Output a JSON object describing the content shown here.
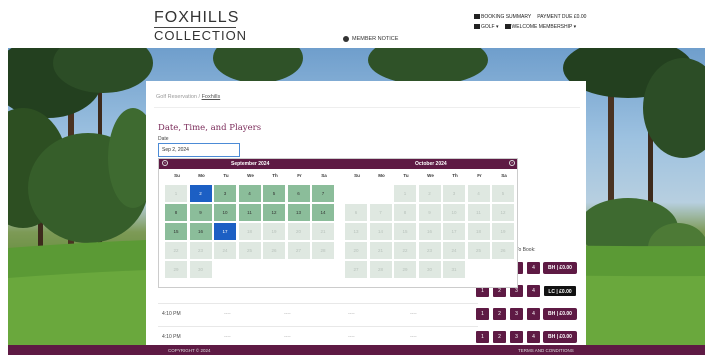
{
  "brand": {
    "line1": "FOXHILLS",
    "line2": "COLLECTION"
  },
  "header": {
    "booking_summary": "BOOKING SUMMARY",
    "payment_due": "PAYMENT DUE £0.00",
    "golf_menu": "GOLF ▾",
    "welcome_menu": "WELCOME MEMBERSHIP ▾",
    "member_notice": "MEMBER NOTICE"
  },
  "breadcrumb": {
    "parent": "Golf Reservation",
    "current": "Foxhills"
  },
  "booking": {
    "section_title": "Date, Time, and Players",
    "date_label": "Date",
    "date_value": "Sep 2, 2024"
  },
  "calendar": {
    "prev": "‹",
    "next": "›",
    "weekdays": [
      "Su",
      "Mo",
      "Tu",
      "We",
      "Th",
      "Fr",
      "Sa"
    ],
    "months": [
      {
        "name": "September 2024",
        "weeks": [
          [
            [
              "1",
              "dim"
            ],
            [
              "2",
              "sel"
            ],
            [
              "3",
              "avail"
            ],
            [
              "4",
              "avail"
            ],
            [
              "5",
              "avail"
            ],
            [
              "6",
              "avail"
            ],
            [
              "7",
              "avail"
            ]
          ],
          [
            [
              "8",
              "avail"
            ],
            [
              "9",
              "avail"
            ],
            [
              "10",
              "avail"
            ],
            [
              "11",
              "avail"
            ],
            [
              "12",
              "avail"
            ],
            [
              "13",
              "avail"
            ],
            [
              "14",
              "avail"
            ]
          ],
          [
            [
              "15",
              "avail"
            ],
            [
              "16",
              "avail"
            ],
            [
              "17",
              "sel"
            ],
            [
              "18",
              "dim"
            ],
            [
              "19",
              "dim"
            ],
            [
              "20",
              "dim"
            ],
            [
              "21",
              "dim"
            ]
          ],
          [
            [
              "22",
              "dim"
            ],
            [
              "23",
              "dim"
            ],
            [
              "24",
              "dim"
            ],
            [
              "25",
              "dim"
            ],
            [
              "26",
              "dim"
            ],
            [
              "27",
              "dim"
            ],
            [
              "28",
              "dim"
            ]
          ],
          [
            [
              "29",
              "dim"
            ],
            [
              "30",
              "dim"
            ]
          ]
        ]
      },
      {
        "name": "October 2024",
        "weeks": [
          [
            [
              "",
              ""
            ],
            [
              "",
              ""
            ],
            [
              "1",
              "dim"
            ],
            [
              "2",
              "dim"
            ],
            [
              "3",
              "dim"
            ],
            [
              "4",
              "dim"
            ],
            [
              "5",
              "dim"
            ]
          ],
          [
            [
              "6",
              "dim"
            ],
            [
              "7",
              "dim"
            ],
            [
              "8",
              "dim"
            ],
            [
              "9",
              "dim"
            ],
            [
              "10",
              "dim"
            ],
            [
              "11",
              "dim"
            ],
            [
              "12",
              "dim"
            ]
          ],
          [
            [
              "13",
              "dim"
            ],
            [
              "14",
              "dim"
            ],
            [
              "15",
              "dim"
            ],
            [
              "16",
              "dim"
            ],
            [
              "17",
              "dim"
            ],
            [
              "18",
              "dim"
            ],
            [
              "19",
              "dim"
            ]
          ],
          [
            [
              "20",
              "dim"
            ],
            [
              "21",
              "dim"
            ],
            [
              "22",
              "dim"
            ],
            [
              "23",
              "dim"
            ],
            [
              "24",
              "dim"
            ],
            [
              "25",
              "dim"
            ],
            [
              "26",
              "dim"
            ]
          ],
          [
            [
              "27",
              "dim"
            ],
            [
              "28",
              "dim"
            ],
            [
              "29",
              "dim"
            ],
            [
              "30",
              "dim"
            ],
            [
              "31",
              "dim"
            ]
          ]
        ]
      }
    ]
  },
  "tee_times": {
    "to_book_label": "To Book:",
    "dash": "----",
    "rows": [
      {
        "time": "",
        "players": [
          "1",
          "2",
          "3",
          "4"
        ],
        "price": "BH | £0.00",
        "style": "purple"
      },
      {
        "time": "",
        "players": [
          "1",
          "2",
          "3",
          "4"
        ],
        "price": "LC | £0.00",
        "style": "dark"
      },
      {
        "time": "4:10 PM",
        "players": [
          "1",
          "2",
          "3",
          "4"
        ],
        "price": "BH | £0.00",
        "style": "purple"
      },
      {
        "time": "4:10 PM",
        "players": [
          "1",
          "2",
          "3",
          "4"
        ],
        "price": "BH | £0.00",
        "style": "purple"
      }
    ]
  },
  "footer": {
    "left": "COPYRIGHT © 2024",
    "right": "TERMS AND CONDITIONS"
  },
  "colors": {
    "brand": "#5e1a44",
    "available": "#8bbd9a",
    "selected": "#1c5fc4",
    "title": "#7b2b5a"
  }
}
